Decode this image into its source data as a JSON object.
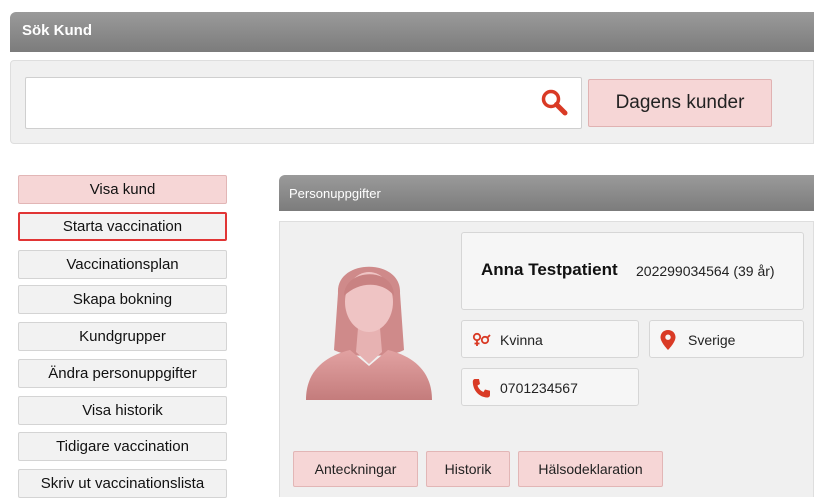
{
  "search": {
    "title": "Sök Kund",
    "input_value": "",
    "placeholder": "",
    "today_button": "Dagens kunder"
  },
  "menu": {
    "items": [
      {
        "label": "Visa kund"
      },
      {
        "label": "Starta vaccination"
      },
      {
        "label": "Vaccinationsplan"
      },
      {
        "label": "Skapa bokning"
      },
      {
        "label": "Kundgrupper"
      },
      {
        "label": "Ändra personuppgifter"
      },
      {
        "label": "Visa historik"
      },
      {
        "label": "Tidigare vaccination"
      },
      {
        "label": "Skriv ut vaccinationslista"
      }
    ]
  },
  "person": {
    "section_title": "Personuppgifter",
    "name": "Anna Testpatient",
    "personnummer": "202299034564 (39 år)",
    "gender": "Kvinna",
    "country": "Sverige",
    "phone": "0701234567"
  },
  "tabs": [
    {
      "label": "Anteckningar"
    },
    {
      "label": "Historik"
    },
    {
      "label": "Hälsodeklaration"
    }
  ],
  "colors": {
    "accent_pink": "#f6d6d6",
    "icon_red": "#d93a25",
    "header_gray": "#8a8a8a",
    "highlight_red": "#e13535"
  }
}
